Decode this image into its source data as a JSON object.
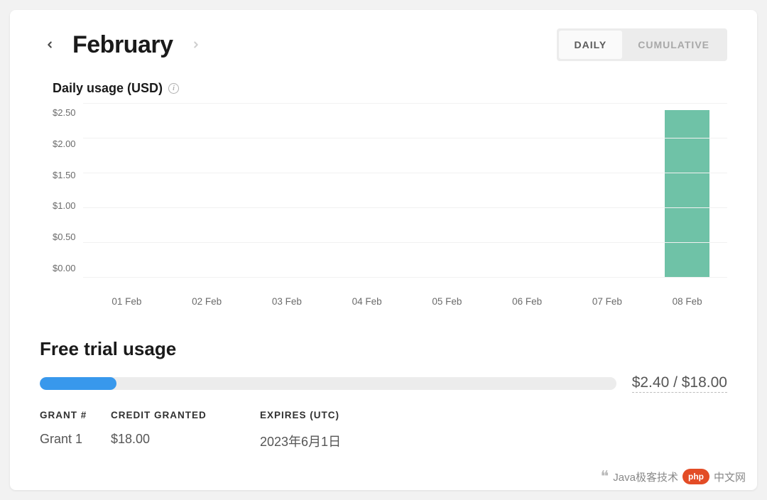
{
  "header": {
    "month": "February",
    "toggle": {
      "daily": "DAILY",
      "cumulative": "CUMULATIVE",
      "active": "daily"
    }
  },
  "chart_title": "Daily usage (USD)",
  "chart_data": {
    "type": "bar",
    "title": "Daily usage (USD)",
    "ylabel": "USD",
    "ylim": [
      0,
      2.5
    ],
    "y_ticks": [
      "$2.50",
      "$2.00",
      "$1.50",
      "$1.00",
      "$0.50",
      "$0.00"
    ],
    "categories": [
      "01 Feb",
      "02 Feb",
      "03 Feb",
      "04 Feb",
      "05 Feb",
      "06 Feb",
      "07 Feb",
      "08 Feb"
    ],
    "values": [
      0,
      0,
      0,
      0,
      0,
      0,
      0,
      2.4
    ]
  },
  "free_trial": {
    "title": "Free trial usage",
    "used": 2.4,
    "total": 18.0,
    "label": "$2.40 / $18.00"
  },
  "grants": {
    "headers": {
      "grant": "GRANT #",
      "credit": "CREDIT GRANTED",
      "expires": "EXPIRES (UTC)"
    },
    "rows": [
      {
        "grant": "Grant 1",
        "credit": "$18.00",
        "expires": "2023年6月1日"
      }
    ]
  },
  "watermark": {
    "prefix": "Java极客技术",
    "logo": "php",
    "suffix": "中文网"
  }
}
